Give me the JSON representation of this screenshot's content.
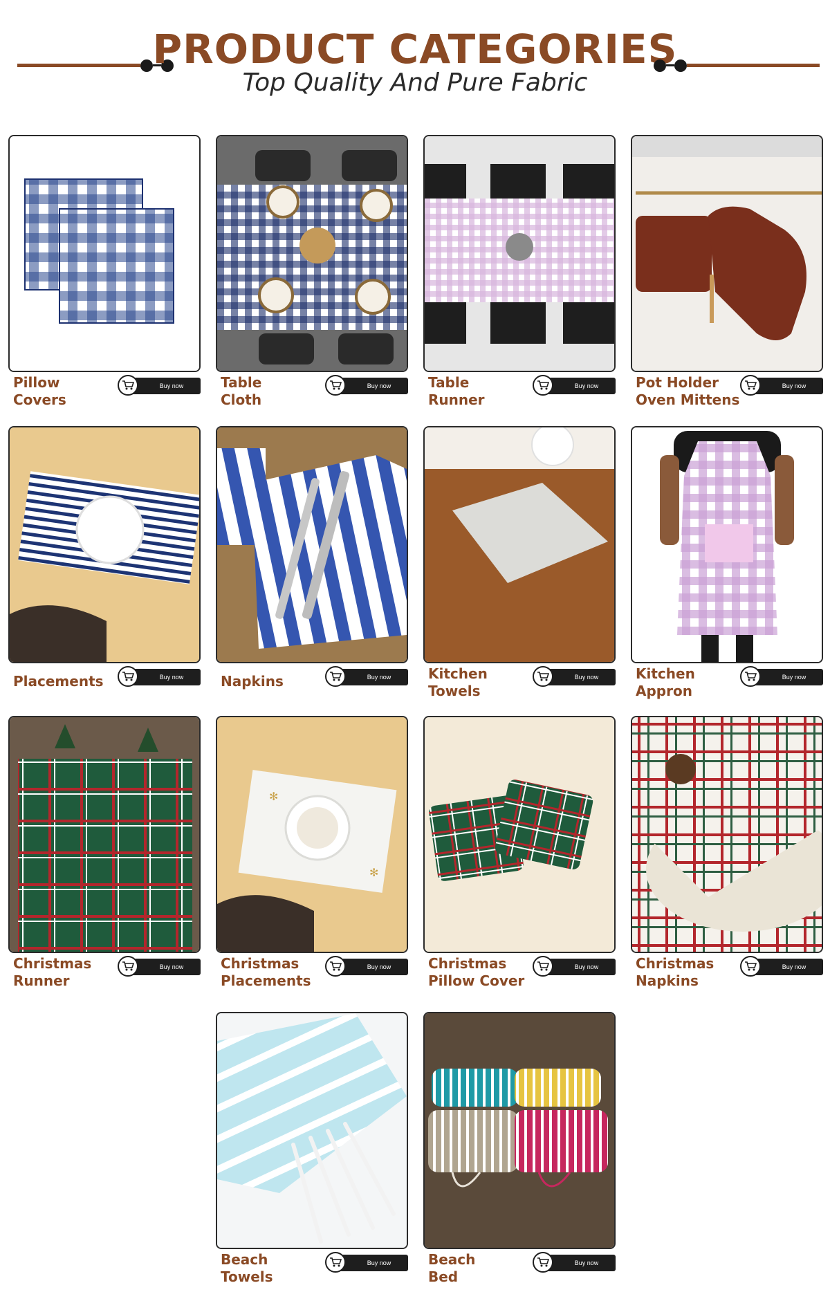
{
  "header": {
    "title": "PRODUCT CATEGORIES",
    "subtitle": "Top Quality And Pure Fabric"
  },
  "colors": {
    "accent": "#8a4a25",
    "button_bg": "#1e1e1e",
    "card_border": "#2b2b2b"
  },
  "buy_label": "Buy now",
  "products": [
    {
      "name": "Pillow\nCovers",
      "icon": "cart-icon"
    },
    {
      "name": "Table\nCloth",
      "icon": "cart-icon"
    },
    {
      "name": "Table\nRunner",
      "icon": "cart-icon"
    },
    {
      "name": "Pot Holder\nOven Mittens",
      "icon": "cart-icon"
    },
    {
      "name": "Placements",
      "icon": "cart-icon"
    },
    {
      "name": "Napkins",
      "icon": "cart-icon"
    },
    {
      "name": "Kitchen\nTowels",
      "icon": "cart-icon"
    },
    {
      "name": "Kitchen\nAppron",
      "icon": "cart-icon"
    },
    {
      "name": "Christmas\nRunner",
      "icon": "cart-icon"
    },
    {
      "name": "Christmas\nPlacements",
      "icon": "cart-icon"
    },
    {
      "name": "Christmas\nPillow Cover",
      "icon": "cart-icon"
    },
    {
      "name": "Christmas\nNapkins",
      "icon": "cart-icon"
    },
    {
      "name": "Beach\nTowels",
      "icon": "cart-icon"
    },
    {
      "name": "Beach\nBed",
      "icon": "cart-icon"
    }
  ]
}
